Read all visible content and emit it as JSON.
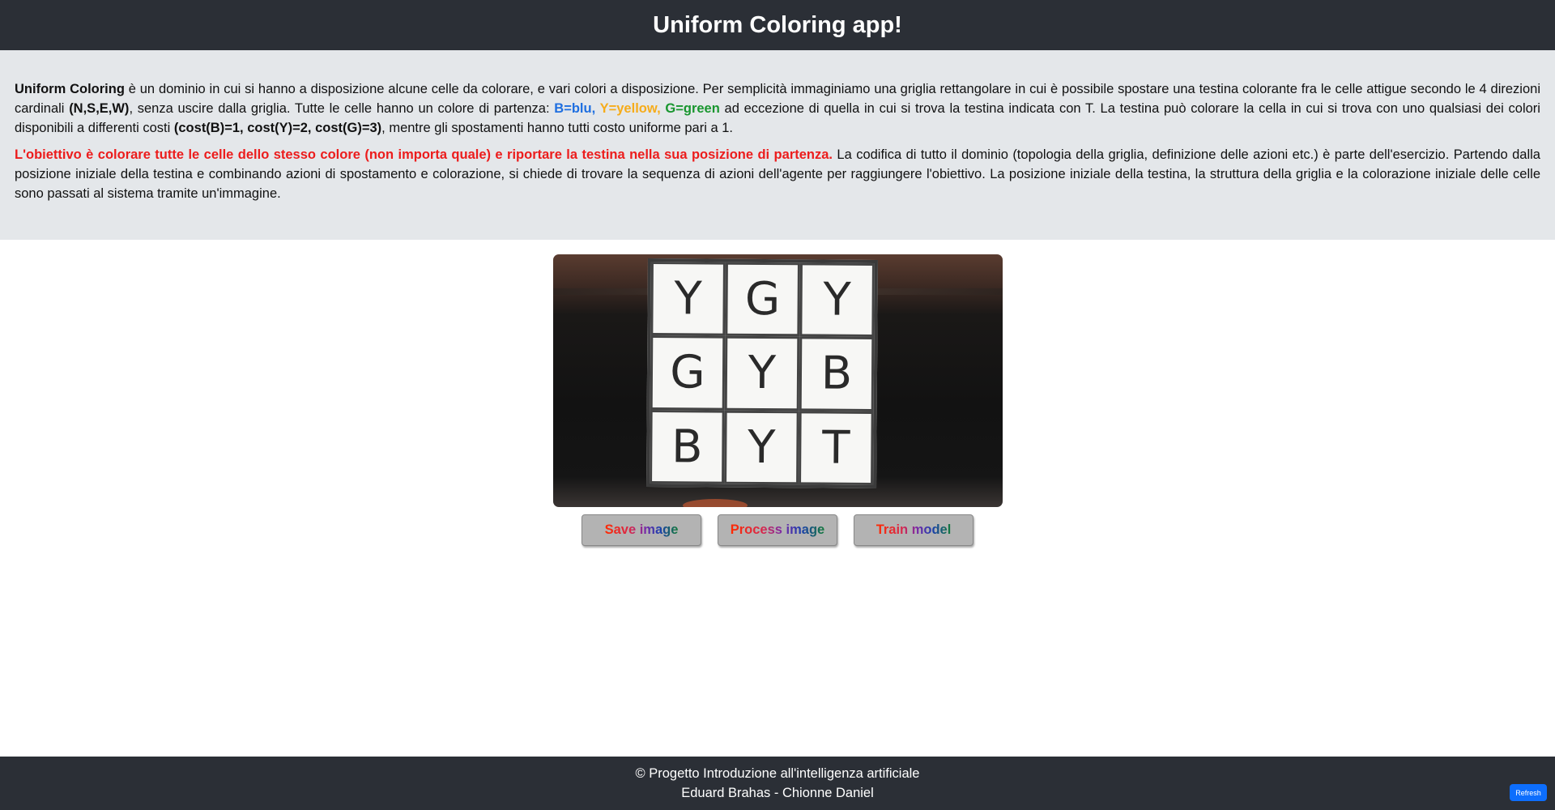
{
  "header": {
    "title": "Uniform Coloring app!"
  },
  "description": {
    "p1": {
      "strong_title": "Uniform Coloring",
      "text1": " è un dominio in cui si hanno a disposizione alcune celle da colorare, e vari colori a disposizione. Per semplicità immaginiamo una griglia rettangolare in cui è possibile spostare una testina colorante fra le celle attigue secondo le 4 direzioni cardinali ",
      "directions": "(N,S,E,W)",
      "text2": ", senza uscire dalla griglia. Tutte le celle hanno un colore di partenza: ",
      "blue": "B=blu,",
      "yellow": " Y=yellow,",
      "green": " G=green",
      "text3": " ad eccezione di quella in cui si trova la testina indicata con T. La testina può colorare la cella in cui si trova con uno qualsiasi dei colori disponibili a differenti costi ",
      "costs": "(cost(B)=1, cost(Y)=2, cost(G)=3)",
      "text4": ", mentre gli spostamenti hanno tutti costo uniforme pari a 1."
    },
    "p2": {
      "objective": "L'obiettivo è colorare tutte le celle dello stesso colore (non importa quale) e riportare la testina nella sua posizione di partenza.",
      "text": " La codifica di tutto il dominio (topologia della griglia, definizione delle azioni etc.) è parte dell'esercizio. Partendo dalla posizione iniziale della testina e combinando azioni di spostamento e colorazione, si chiede di trovare la sequenza di azioni dell'agente per raggiungere l'obiettivo. La posizione iniziale della testina, la struttura della griglia e la colorazione iniziale delle celle sono passati al sistema tramite un'immagine."
    }
  },
  "image": {
    "cells": [
      "Y",
      "G",
      "Y",
      "G",
      "Y",
      "B",
      "B",
      "Y",
      "T"
    ]
  },
  "buttons": {
    "save": "Save image",
    "process": "Process image",
    "train": "Train model"
  },
  "footer": {
    "line1": "© Progetto Introduzione all'intelligenza artificiale",
    "line2": "Eduard Brahas - Chionne Daniel",
    "refresh": "Refresh"
  },
  "colors": {
    "header_bg": "#2b2f36",
    "panel_bg": "#e4e7ea",
    "blue": "#1f6fe0",
    "yellow": "#f6ac1a",
    "green": "#19962f",
    "red": "#ec1c1c",
    "refresh_bg": "#0d6efd"
  }
}
